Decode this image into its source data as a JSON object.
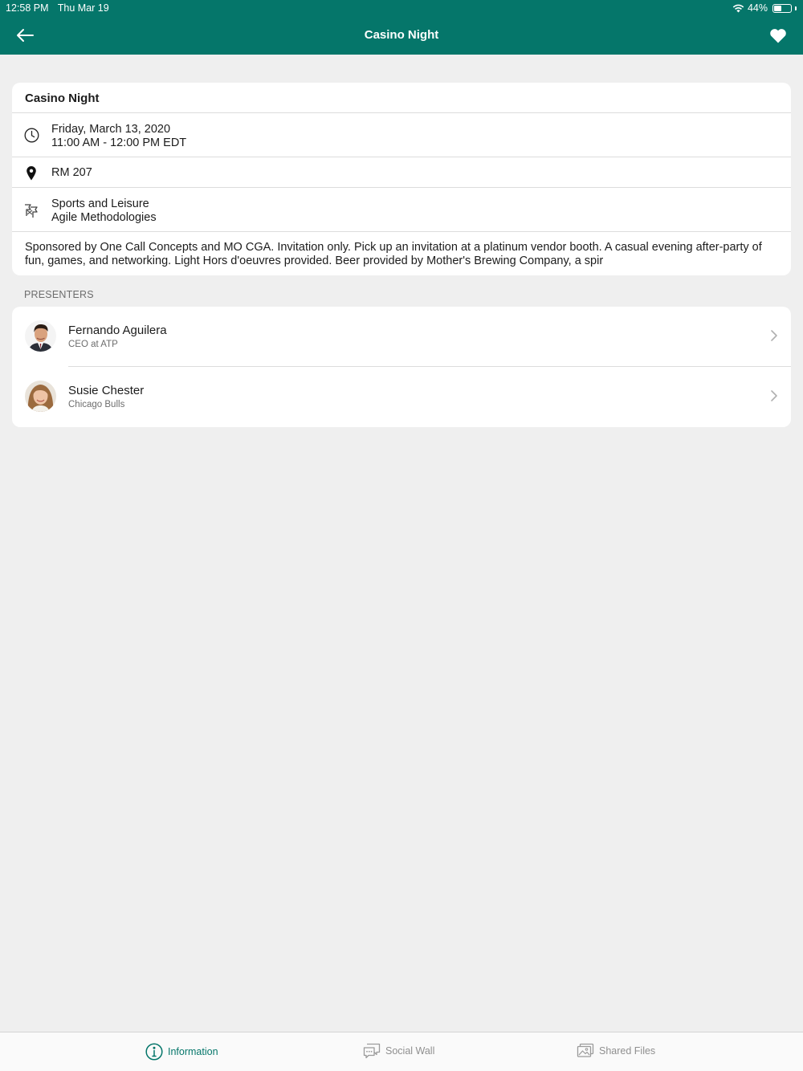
{
  "status_bar": {
    "time": "12:58 PM",
    "date": "Thu Mar 19",
    "battery": "44%",
    "battery_level": 0.44
  },
  "nav": {
    "title": "Casino Night",
    "back_icon": "arrow-left-icon",
    "favorite_icon": "heart-icon"
  },
  "event": {
    "title": "Casino Night",
    "date_line": "Friday, March 13, 2020",
    "time_line": "11:00 AM - 12:00 PM EDT",
    "location": "RM 207",
    "tracks": [
      "Sports and Leisure",
      "Agile Methodologies"
    ],
    "description": "Sponsored by One Call Concepts and MO CGA. Invitation only. Pick up an invitation at a platinum vendor booth. A casual evening after-party of fun, games, and networking. Light Hors d'oeuvres provided. Beer provided by Mother's Brewing Company, a spir"
  },
  "presenters": {
    "label": "PRESENTERS",
    "items": [
      {
        "name": "Fernando Aguilera",
        "subtitle": "CEO at ATP"
      },
      {
        "name": "Susie Chester",
        "subtitle": "Chicago Bulls"
      }
    ]
  },
  "tabs": [
    {
      "label": "Information",
      "icon": "info-icon",
      "active": true
    },
    {
      "label": "Social Wall",
      "icon": "chat-icon",
      "active": false
    },
    {
      "label": "Shared Files",
      "icon": "image-icon",
      "active": false
    }
  ],
  "colors": {
    "brand": "#05766a",
    "background": "#efefef",
    "card": "#ffffff",
    "secondary_text": "#6d6d6d"
  }
}
